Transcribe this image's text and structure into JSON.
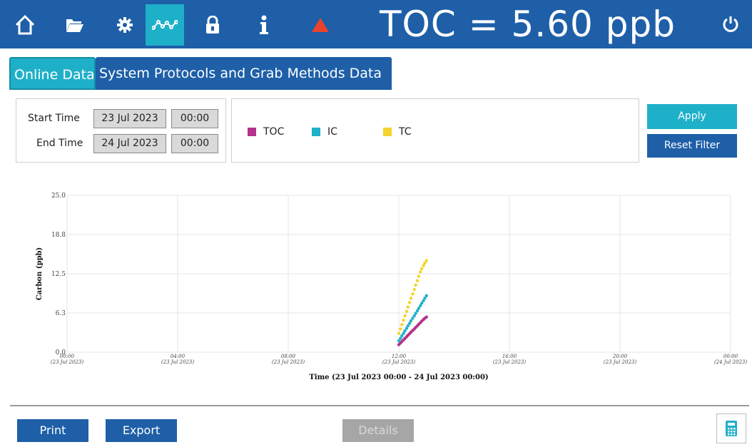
{
  "header": {
    "nav": [
      {
        "name": "home-icon"
      },
      {
        "name": "folder-icon"
      },
      {
        "name": "gear-icon"
      },
      {
        "name": "trend-icon",
        "active": true
      },
      {
        "name": "lock-icon"
      },
      {
        "name": "info-icon"
      },
      {
        "name": "alarm-triangle-icon"
      }
    ],
    "reading": "TOC = 5.60 ppb",
    "power_icon": "power-icon"
  },
  "tabs": [
    {
      "label": "Online Data",
      "active": true
    },
    {
      "label": "System Protocols and Grab Methods Data",
      "active": false
    }
  ],
  "filter": {
    "start_label": "Start Time",
    "start_date": "23 Jul 2023",
    "start_time": "00:00",
    "end_label": "End Time",
    "end_date": "24 Jul 2023",
    "end_time": "00:00"
  },
  "legend": [
    {
      "label": "TOC",
      "color": "#b5338a"
    },
    {
      "label": "IC",
      "color": "#1fb0c9"
    },
    {
      "label": "TC",
      "color": "#f5d32a"
    }
  ],
  "buttons": {
    "apply": "Apply",
    "reset": "Reset Filter",
    "print": "Print",
    "export": "Export",
    "details": "Details",
    "calculator_icon": "calculator-icon"
  },
  "colors": {
    "brand_blue": "#1e5fa8",
    "accent_cyan": "#1fb0c9",
    "disabled_gray": "#a6a6a6"
  },
  "chart_data": {
    "type": "scatter",
    "ylabel": "Carbon (ppb)",
    "xlabel": "Time (23 Jul 2023 00:00 - 24 Jul 2023 00:00)",
    "ylim": [
      0,
      25
    ],
    "xlim_hours": [
      0,
      24
    ],
    "y_ticks": [
      "0.0",
      "6.3",
      "12.5",
      "18.8",
      "25.0"
    ],
    "x_ticks": [
      {
        "time": "00:00",
        "date": "(23 Jul 2023)"
      },
      {
        "time": "04:00",
        "date": "(23 Jul 2023)"
      },
      {
        "time": "08:00",
        "date": "(23 Jul 2023)"
      },
      {
        "time": "12:00",
        "date": "(23 Jul 2023)"
      },
      {
        "time": "16:00",
        "date": "(23 Jul 2023)"
      },
      {
        "time": "20:00",
        "date": "(23 Jul 2023)"
      },
      {
        "time": "00:00",
        "date": "(24 Jul 2023)"
      }
    ],
    "grid": true,
    "series": [
      {
        "name": "TOC",
        "color": "#b5338a",
        "x_hours": [
          12.0,
          12.06,
          12.11,
          12.17,
          12.22,
          12.28,
          12.33,
          12.39,
          12.44,
          12.5,
          12.56,
          12.61,
          12.67,
          12.72,
          12.78,
          12.83,
          12.89,
          12.94,
          13.0
        ],
        "values": [
          1.2,
          1.45,
          1.7,
          1.95,
          2.2,
          2.45,
          2.7,
          2.95,
          3.2,
          3.45,
          3.7,
          3.95,
          4.2,
          4.45,
          4.7,
          4.95,
          5.2,
          5.4,
          5.6
        ]
      },
      {
        "name": "IC",
        "color": "#1fb0c9",
        "x_hours": [
          12.0,
          12.06,
          12.11,
          12.17,
          12.22,
          12.28,
          12.33,
          12.39,
          12.44,
          12.5,
          12.56,
          12.61,
          12.67,
          12.72,
          12.78,
          12.83,
          12.89,
          12.94,
          13.0
        ],
        "values": [
          1.8,
          2.2,
          2.6,
          3.0,
          3.4,
          3.8,
          4.2,
          4.6,
          5.0,
          5.4,
          5.8,
          6.2,
          6.6,
          7.0,
          7.4,
          7.8,
          8.2,
          8.6,
          9.0
        ]
      },
      {
        "name": "TC",
        "color": "#f5d32a",
        "x_hours": [
          12.0,
          12.06,
          12.11,
          12.17,
          12.22,
          12.28,
          12.33,
          12.39,
          12.44,
          12.5,
          12.56,
          12.61,
          12.67,
          12.72,
          12.78,
          12.83,
          12.89,
          12.94,
          13.0
        ],
        "values": [
          3.0,
          3.7,
          4.4,
          5.1,
          5.8,
          6.5,
          7.2,
          7.9,
          8.6,
          9.3,
          10.0,
          10.7,
          11.4,
          12.1,
          12.8,
          13.3,
          13.8,
          14.2,
          14.6
        ]
      }
    ]
  }
}
